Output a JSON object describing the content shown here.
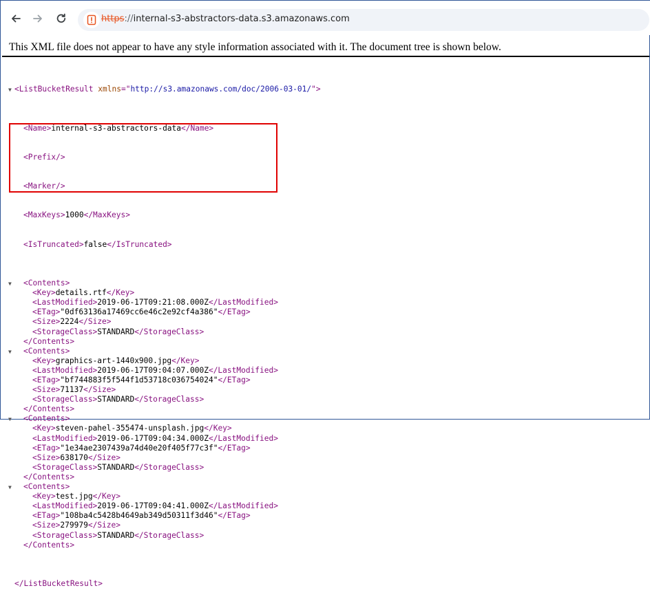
{
  "browser": {
    "url_scheme": "https",
    "url_separator": "://",
    "url_host": "internal-s3-abstractors-data.s3.amazonaws.com",
    "back_icon": "arrow-left-icon",
    "forward_icon": "arrow-right-icon",
    "reload_icon": "reload-icon",
    "site_icon": "not-secure-icon",
    "accent_color": "#e8531f"
  },
  "info_text": "This XML file does not appear to have any style information associated with it. The document tree is shown below.",
  "xml": {
    "root_open": "<ListBucketResult",
    "root_attr_name": "xmlns",
    "root_attr_eq": "=\"",
    "root_attr_value": "http://s3.amazonaws.com/doc/2006-03-01/",
    "root_attr_close": "\">",
    "root_close": "</ListBucketResult>",
    "name_open": "<Name>",
    "name_value": "internal-s3-abstractors-data",
    "name_close": "</Name>",
    "prefix": "<Prefix/>",
    "marker": "<Marker/>",
    "maxkeys_open": "<MaxKeys>",
    "maxkeys_value": "1000",
    "maxkeys_close": "</MaxKeys>",
    "truncated_open": "<IsTruncated>",
    "truncated_value": "false",
    "truncated_close": "</IsTruncated>",
    "contents_open": "<Contents>",
    "contents_close": "</Contents>",
    "key_open": "<Key>",
    "key_close": "</Key>",
    "lm_open": "<LastModified>",
    "lm_close": "</LastModified>",
    "etag_open": "<ETag>",
    "etag_close": "</ETag>",
    "size_open": "<Size>",
    "size_close": "</Size>",
    "sc_open": "<StorageClass>",
    "sc_close": "</StorageClass>",
    "contents": [
      {
        "key": "details.rtf",
        "last_modified": "2019-06-17T09:21:08.000Z",
        "etag": "\"0df63136a17469cc6e46c2e92cf4a386\"",
        "size": "2224",
        "storage_class": "STANDARD"
      },
      {
        "key": "graphics-art-1440x900.jpg",
        "last_modified": "2019-06-17T09:04:07.000Z",
        "etag": "\"bf744883f5f544f1d53718c036754024\"",
        "size": "71137",
        "storage_class": "STANDARD"
      },
      {
        "key": "steven-pahel-355474-unsplash.jpg",
        "last_modified": "2019-06-17T09:04:34.000Z",
        "etag": "\"1e34ae2307439a74d40e20f405f77c3f\"",
        "size": "638170",
        "storage_class": "STANDARD"
      },
      {
        "key": "test.jpg",
        "last_modified": "2019-06-17T09:04:41.000Z",
        "etag": "\"108ba4c5428b4649ab349d50311f3d46\"",
        "size": "279979",
        "storage_class": "STANDARD"
      }
    ],
    "collapse_icon": "triangle-down-icon",
    "highlight_color": "#e00000"
  }
}
